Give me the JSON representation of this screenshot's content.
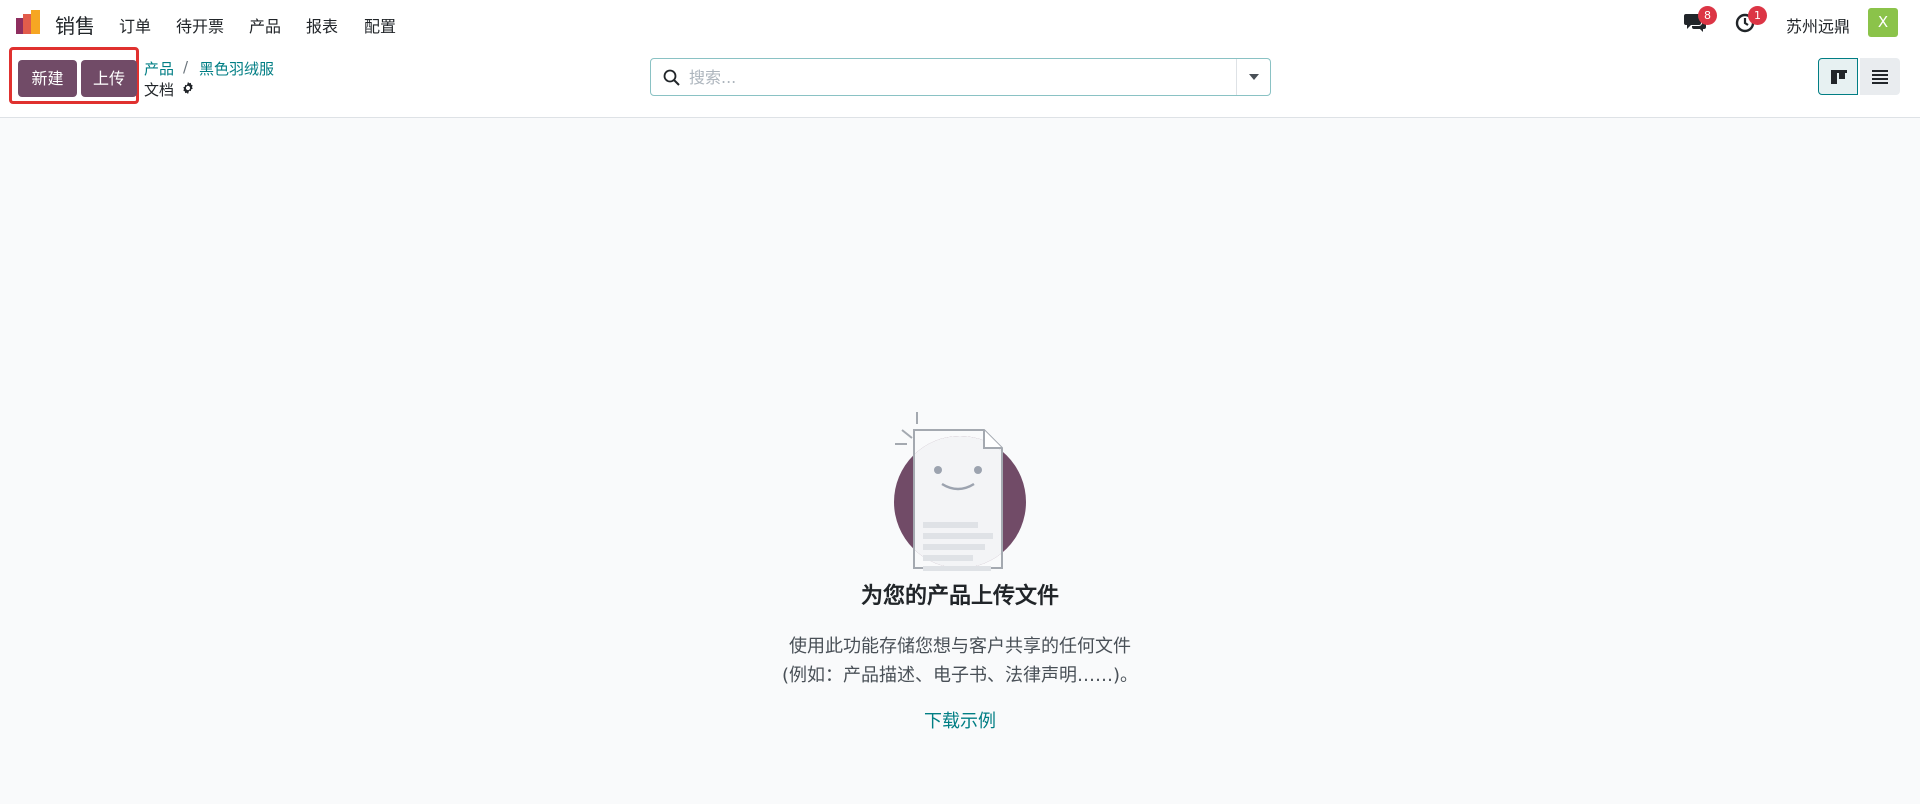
{
  "navbar": {
    "app_name": "销售",
    "menu": [
      "订单",
      "待开票",
      "产品",
      "报表",
      "配置"
    ],
    "messages_count": "8",
    "activities_count": "1",
    "company": "苏州远鼎",
    "user_initial": "X"
  },
  "control_panel": {
    "new_label": "新建",
    "upload_label": "上传",
    "breadcrumb": [
      "产品",
      "黑色羽绒服"
    ],
    "breadcrumb_sep": "/",
    "current_page": "文档",
    "search_placeholder": "搜索..."
  },
  "empty_state": {
    "title": "为您的产品上传文件",
    "line1": "使用此功能存储您想与客户共享的任何文件",
    "line2": "(例如：产品描述、电子书、法律声明……)。",
    "link": "下载示例"
  },
  "icons": {
    "app": "sales-bar-chart-icon",
    "messages": "chat-bubbles-icon",
    "activities": "clock-icon",
    "settings": "gear-icon",
    "search": "search-icon",
    "dropdown": "caret-down-icon",
    "kanban": "kanban-view-icon",
    "list": "list-view-icon"
  },
  "colors": {
    "brand": "#714b67",
    "link": "#017e84",
    "badge": "#dc3545",
    "avatar": "#8bc34a",
    "highlight": "#e0312f"
  }
}
